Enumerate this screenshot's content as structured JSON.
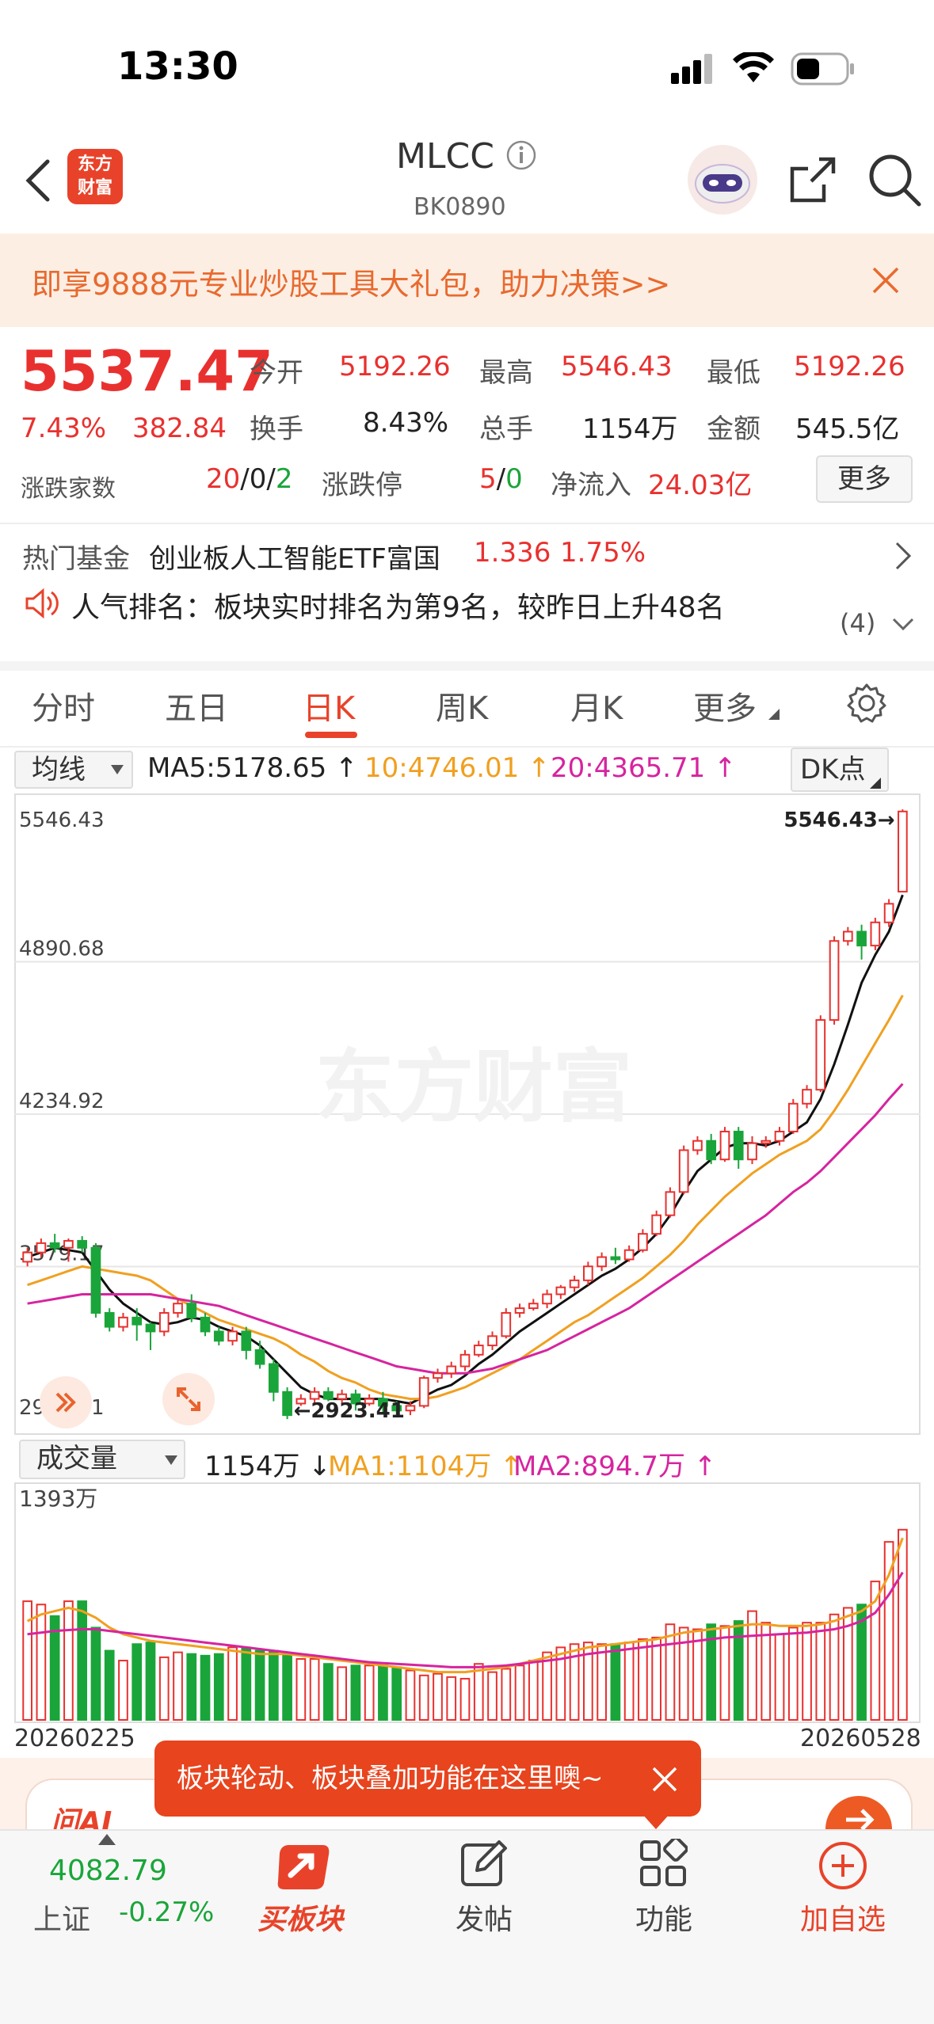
{
  "status_bar": {
    "time": "13:30"
  },
  "header": {
    "logo_text_1": "东方",
    "logo_text_2": "财富",
    "title": "MLCC",
    "code": "BK0890"
  },
  "banner": {
    "text": "即享9888元专业炒股工具大礼包，助力决策>>"
  },
  "quote": {
    "price": "5537.47",
    "change_pct": "7.43%",
    "change": "382.84",
    "open_label": "今开",
    "open": "5192.26",
    "high_label": "最高",
    "high": "5546.43",
    "low_label": "最低",
    "low": "5192.26",
    "turnover_label": "换手",
    "turnover": "8.43%",
    "volume_label": "总手",
    "volume": "1154万",
    "amount_label": "金额",
    "amount": "545.5亿",
    "advdec_label": "涨跌家数",
    "adv": "20",
    "sep1": "/",
    "flat": "0",
    "sep2": "/",
    "dec": "2",
    "limit_label": "涨跌停",
    "limit_up": "5",
    "sep3": "/",
    "limit_down": "0",
    "inflow_label": "净流入",
    "inflow": "24.03亿",
    "more_label": "更多"
  },
  "fund": {
    "label": "热门基金",
    "name": "创业板人工智能ETF富国",
    "price": "1.336",
    "pct": "1.75%"
  },
  "rank": {
    "text": "人气排名：板块实时排名为第9名，较昨日上升48名",
    "count": "(4)"
  },
  "tabs": [
    "分时",
    "五日",
    "日K",
    "周K",
    "月K",
    "更多"
  ],
  "ma_bar": {
    "selector": "均线",
    "ma5": "MA5:5178.65",
    "ma10": "10:4746.01",
    "ma20": "20:4365.71",
    "dk": "DK点"
  },
  "chart_data": {
    "type": "candlestick",
    "y_labels": [
      "5546.43",
      "4890.68",
      "4234.92",
      "3579.17",
      "2923.41"
    ],
    "ylim": [
      2923.41,
      5546.43
    ],
    "high_marker": "5546.43",
    "low_marker": "2923.41",
    "watermark": "东方财富",
    "candles": [
      [
        3600,
        3640,
        3660,
        3580
      ],
      [
        3640,
        3680,
        3700,
        3620
      ],
      [
        3680,
        3660,
        3720,
        3640
      ],
      [
        3660,
        3690,
        3700,
        3600
      ],
      [
        3690,
        3660,
        3710,
        3640
      ],
      [
        3660,
        3380,
        3680,
        3360
      ],
      [
        3380,
        3320,
        3400,
        3300
      ],
      [
        3320,
        3360,
        3380,
        3300
      ],
      [
        3360,
        3330,
        3400,
        3260
      ],
      [
        3330,
        3300,
        3340,
        3220
      ],
      [
        3300,
        3380,
        3400,
        3280
      ],
      [
        3380,
        3420,
        3440,
        3360
      ],
      [
        3420,
        3360,
        3460,
        3340
      ],
      [
        3360,
        3300,
        3380,
        3280
      ],
      [
        3300,
        3260,
        3320,
        3240
      ],
      [
        3260,
        3300,
        3320,
        3240
      ],
      [
        3300,
        3220,
        3320,
        3180
      ],
      [
        3220,
        3160,
        3260,
        3140
      ],
      [
        3160,
        3040,
        3180,
        3000
      ],
      [
        3040,
        2940,
        3060,
        2923
      ],
      [
        2990,
        3010,
        3030,
        2980
      ],
      [
        3010,
        3040,
        3060,
        2990
      ],
      [
        3040,
        3010,
        3060,
        3000
      ],
      [
        3010,
        3030,
        3050,
        2990
      ],
      [
        3030,
        2990,
        3050,
        2960
      ],
      [
        2990,
        3010,
        3030,
        2980
      ],
      [
        3010,
        2980,
        3040,
        2950
      ],
      [
        2980,
        2960,
        3000,
        2940
      ],
      [
        2960,
        2980,
        3000,
        2940
      ],
      [
        2980,
        3100,
        3110,
        2970
      ],
      [
        3100,
        3120,
        3140,
        3080
      ],
      [
        3120,
        3150,
        3170,
        3100
      ],
      [
        3150,
        3200,
        3220,
        3130
      ],
      [
        3200,
        3240,
        3260,
        3190
      ],
      [
        3240,
        3280,
        3300,
        3220
      ],
      [
        3280,
        3380,
        3400,
        3270
      ],
      [
        3380,
        3400,
        3420,
        3360
      ],
      [
        3400,
        3420,
        3440,
        3390
      ],
      [
        3420,
        3460,
        3480,
        3400
      ],
      [
        3460,
        3490,
        3500,
        3440
      ],
      [
        3490,
        3520,
        3540,
        3470
      ],
      [
        3520,
        3580,
        3600,
        3500
      ],
      [
        3580,
        3620,
        3640,
        3560
      ],
      [
        3620,
        3610,
        3660,
        3590
      ],
      [
        3610,
        3650,
        3670,
        3600
      ],
      [
        3650,
        3720,
        3740,
        3640
      ],
      [
        3720,
        3800,
        3820,
        3710
      ],
      [
        3800,
        3900,
        3920,
        3790
      ],
      [
        3900,
        4080,
        4100,
        3890
      ],
      [
        4080,
        4120,
        4140,
        4060
      ],
      [
        4120,
        4040,
        4150,
        4020
      ],
      [
        4040,
        4160,
        4180,
        4030
      ],
      [
        4160,
        4040,
        4180,
        4000
      ],
      [
        4040,
        4110,
        4140,
        4020
      ],
      [
        4110,
        4120,
        4140,
        4090
      ],
      [
        4120,
        4160,
        4180,
        4100
      ],
      [
        4160,
        4280,
        4300,
        4150
      ],
      [
        4280,
        4340,
        4360,
        4260
      ],
      [
        4340,
        4640,
        4660,
        4330
      ],
      [
        4640,
        4980,
        5000,
        4620
      ],
      [
        4980,
        5020,
        5040,
        4960
      ],
      [
        5020,
        4960,
        5050,
        4900
      ],
      [
        4960,
        5060,
        5080,
        4940
      ],
      [
        5060,
        5140,
        5160,
        5040
      ],
      [
        5192,
        5537,
        5546,
        5192
      ]
    ],
    "ma5": [
      3620,
      3640,
      3660,
      3650,
      3640,
      3560,
      3480,
      3420,
      3380,
      3340,
      3330,
      3340,
      3360,
      3350,
      3320,
      3300,
      3280,
      3240,
      3180,
      3120,
      3060,
      3030,
      3010,
      3010,
      3010,
      3010,
      3010,
      3000,
      2990,
      3020,
      3050,
      3070,
      3110,
      3160,
      3200,
      3250,
      3300,
      3340,
      3380,
      3420,
      3460,
      3500,
      3540,
      3570,
      3610,
      3660,
      3720,
      3800,
      3900,
      3990,
      4040,
      4090,
      4110,
      4110,
      4100,
      4120,
      4160,
      4200,
      4300,
      4450,
      4620,
      4800,
      4920,
      5020,
      5178
    ],
    "ma10": [
      3500,
      3520,
      3540,
      3560,
      3580,
      3570,
      3560,
      3550,
      3540,
      3520,
      3480,
      3440,
      3410,
      3380,
      3350,
      3330,
      3310,
      3290,
      3270,
      3240,
      3200,
      3170,
      3130,
      3100,
      3080,
      3050,
      3030,
      3020,
      3010,
      3010,
      3020,
      3040,
      3060,
      3090,
      3120,
      3150,
      3180,
      3220,
      3260,
      3300,
      3340,
      3370,
      3410,
      3450,
      3490,
      3530,
      3580,
      3630,
      3690,
      3760,
      3820,
      3880,
      3930,
      3980,
      4020,
      4060,
      4090,
      4120,
      4170,
      4250,
      4340,
      4440,
      4540,
      4640,
      4746
    ],
    "ma20": [
      3420,
      3430,
      3440,
      3450,
      3460,
      3460,
      3460,
      3460,
      3460,
      3460,
      3450,
      3440,
      3430,
      3420,
      3410,
      3390,
      3370,
      3350,
      3330,
      3310,
      3290,
      3270,
      3250,
      3230,
      3210,
      3190,
      3170,
      3150,
      3140,
      3130,
      3120,
      3120,
      3120,
      3130,
      3140,
      3160,
      3180,
      3200,
      3220,
      3250,
      3280,
      3310,
      3340,
      3370,
      3400,
      3440,
      3480,
      3520,
      3560,
      3600,
      3640,
      3680,
      3720,
      3760,
      3800,
      3850,
      3900,
      3940,
      3990,
      4050,
      4110,
      4170,
      4230,
      4300,
      4365
    ]
  },
  "volume_bar": {
    "selector": "成交量",
    "value": "1154万",
    "ma1": "MA1:1104万",
    "ma2": "MA2:894.7万",
    "max_label": "1393万",
    "start_date": "20260225",
    "end_date": "20260528"
  },
  "volume_data": {
    "values": [
      720,
      700,
      630,
      720,
      720,
      560,
      420,
      360,
      460,
      470,
      380,
      410,
      400,
      390,
      400,
      440,
      440,
      420,
      420,
      400,
      370,
      370,
      340,
      320,
      330,
      330,
      330,
      320,
      300,
      270,
      280,
      260,
      250,
      340,
      290,
      310,
      330,
      360,
      410,
      440,
      460,
      470,
      460,
      460,
      470,
      490,
      500,
      580,
      560,
      550,
      580,
      570,
      600,
      660,
      590,
      520,
      560,
      590,
      590,
      640,
      680,
      700,
      840,
      1080,
      1154
    ],
    "ma1": [
      600,
      640,
      660,
      680,
      660,
      620,
      560,
      520,
      500,
      480,
      470,
      460,
      450,
      440,
      430,
      420,
      410,
      400,
      400,
      400,
      390,
      380,
      370,
      360,
      350,
      340,
      330,
      320,
      310,
      300,
      290,
      290,
      290,
      300,
      310,
      320,
      340,
      360,
      380,
      400,
      420,
      440,
      450,
      460,
      470,
      480,
      490,
      510,
      530,
      540,
      550,
      560,
      570,
      580,
      580,
      570,
      570,
      570,
      580,
      600,
      630,
      660,
      720,
      880,
      1104
    ],
    "ma2": [
      520,
      530,
      540,
      545,
      550,
      550,
      540,
      530,
      520,
      510,
      500,
      490,
      480,
      470,
      460,
      450,
      440,
      430,
      420,
      410,
      400,
      390,
      380,
      370,
      360,
      350,
      345,
      340,
      335,
      330,
      325,
      320,
      320,
      320,
      325,
      330,
      340,
      350,
      360,
      370,
      385,
      400,
      410,
      420,
      430,
      440,
      450,
      460,
      470,
      480,
      490,
      500,
      505,
      510,
      515,
      520,
      525,
      530,
      540,
      550,
      570,
      600,
      650,
      760,
      895
    ]
  },
  "ai_bar": {
    "logo": "问AI"
  },
  "tooltip": {
    "text": "板块轮动、板块叠加功能在这里噢~"
  },
  "bottom_nav": {
    "index_value": "4082.79",
    "index_name": "上证",
    "index_pct": "-0.27%",
    "buy_label": "买板块",
    "post_label": "发帖",
    "func_label": "功能",
    "add_label": "加自选"
  }
}
